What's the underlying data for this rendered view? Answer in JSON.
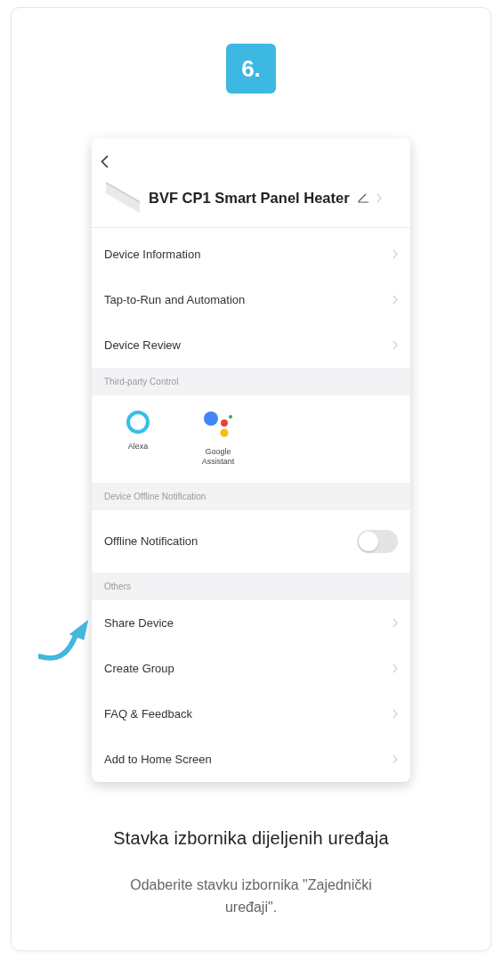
{
  "step_badge": "6.",
  "app_screen": {
    "device_name": "BVF CP1 Smart Panel Heater",
    "sections": [
      {
        "kind": "links",
        "items": [
          {
            "label": "Device Information"
          },
          {
            "label": "Tap-to-Run and Automation"
          },
          {
            "label": "Device Review"
          }
        ]
      },
      {
        "kind": "integrations",
        "header": "Third-party Control",
        "items": [
          {
            "label": "Alexa"
          },
          {
            "label": "Google Assistant"
          }
        ]
      },
      {
        "kind": "toggle",
        "header": "Device Offline Notification",
        "items": [
          {
            "label": "Offline Notification",
            "on": false
          }
        ]
      },
      {
        "kind": "links",
        "header": "Others",
        "items": [
          {
            "label": "Share Device"
          },
          {
            "label": "Create Group"
          },
          {
            "label": "FAQ & Feedback"
          },
          {
            "label": "Add to Home Screen"
          }
        ]
      }
    ]
  },
  "title": "Stavka izbornika dijeljenih uređaja",
  "description": "Odaberite stavku izbornika \"Zajednički uređaji\"."
}
